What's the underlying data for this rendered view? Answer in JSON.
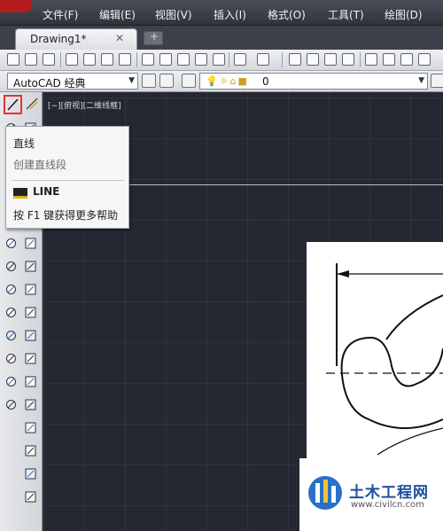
{
  "menu": {
    "items": [
      "文件(F)",
      "编辑(E)",
      "视图(V)",
      "插入(I)",
      "格式(O)",
      "工具(T)",
      "绘图(D)"
    ]
  },
  "tabs": {
    "document": "Drawing1*",
    "close": "✕"
  },
  "workspace": {
    "value": "AutoCAD 经典"
  },
  "layer": {
    "value": "0"
  },
  "viewport": {
    "label": "[−][俯视][二维线框]"
  },
  "tooltip": {
    "title": "直线",
    "description": "创建直线段",
    "command": "LINE",
    "help": "按 F1 键获得更多帮助"
  },
  "watermark": {
    "name": "土木工程网",
    "url": "www.civilcn.com"
  },
  "colors": {
    "canvas": "#252833",
    "highlight": "#e23333",
    "brand": "#1d4f9a"
  }
}
